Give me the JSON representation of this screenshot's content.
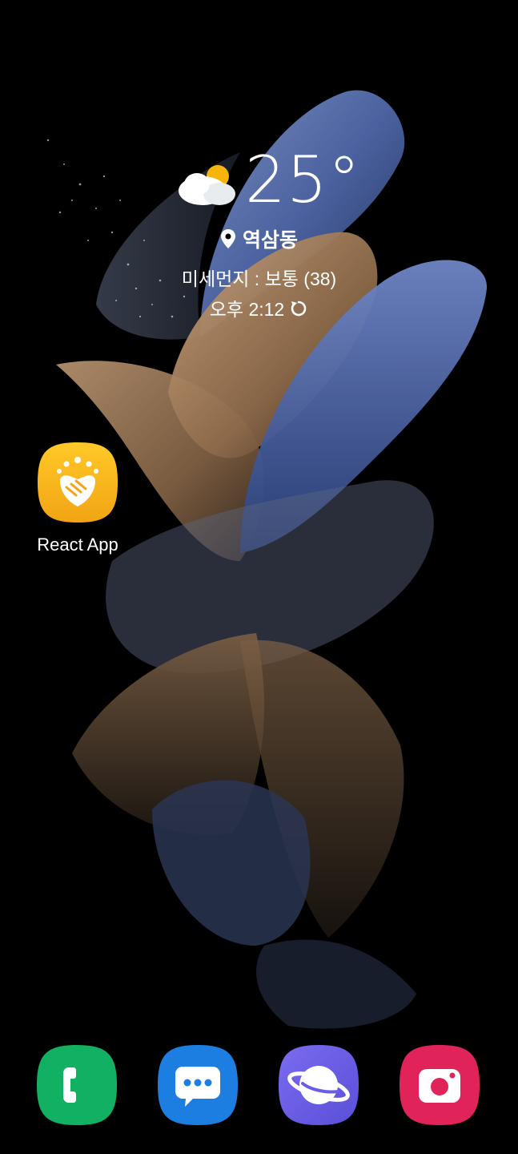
{
  "weather": {
    "icon": "partly-cloudy-icon",
    "temperature": "25°",
    "location": "역삼동",
    "fine_dust": "미세먼지 : 보통 (38)",
    "updated": "오후 2:12"
  },
  "home_apps": [
    {
      "label": "React App",
      "icon": "handshake-icon",
      "color": "#f5b21a"
    }
  ],
  "dock": [
    {
      "name": "phone",
      "icon": "phone-icon",
      "color": "#12b062"
    },
    {
      "name": "messages",
      "icon": "message-icon",
      "color": "#1c7ee0"
    },
    {
      "name": "internet",
      "icon": "planet-icon",
      "color": "#6a5ee8"
    },
    {
      "name": "camera",
      "icon": "camera-icon",
      "color": "#e0245a"
    }
  ]
}
